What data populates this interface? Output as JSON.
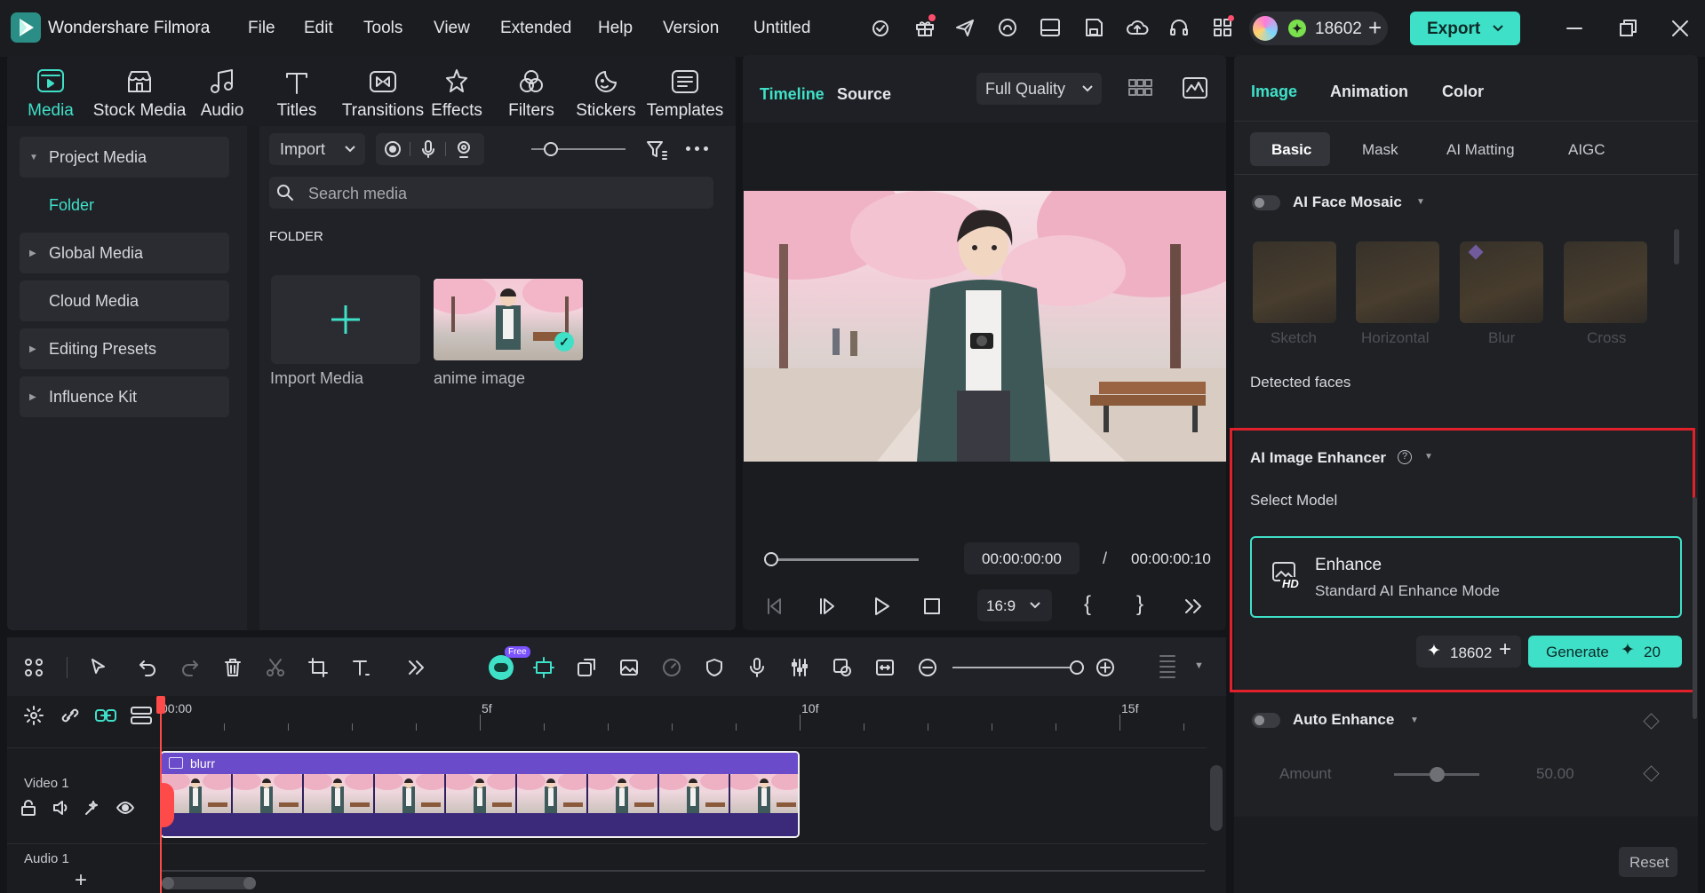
{
  "app": {
    "name": "Wondershare Filmora",
    "project": "Untitled",
    "credits": "18602",
    "export_label": "Export"
  },
  "menu": [
    "File",
    "Edit",
    "Tools",
    "View",
    "Extended",
    "Help",
    "Version"
  ],
  "media_tabs": [
    "Media",
    "Stock Media",
    "Audio",
    "Titles",
    "Transitions",
    "Effects",
    "Filters",
    "Stickers",
    "Templates"
  ],
  "sidebar": {
    "items": [
      "Project Media",
      "Folder",
      "Global Media",
      "Cloud Media",
      "Editing Presets",
      "Influence Kit"
    ]
  },
  "media": {
    "import_label": "Import",
    "search_placeholder": "Search media",
    "folder_label": "FOLDER",
    "items": [
      "Import Media",
      "anime image"
    ]
  },
  "preview": {
    "tabs": [
      "Timeline",
      "Source"
    ],
    "quality": "Full Quality",
    "current_time": "00:00:00:00",
    "separator": "/",
    "total_time": "00:00:00:10",
    "ratio": "16:9",
    "progress": 0
  },
  "timeline": {
    "ruler": [
      "00:00",
      "5f",
      "10f",
      "15f"
    ],
    "clip_name": "blurr",
    "tracks": [
      "Video 1",
      "Audio 1"
    ],
    "free_badge": "Free"
  },
  "properties": {
    "tabs": [
      "Image",
      "Animation",
      "Color"
    ],
    "subtabs": [
      "Basic",
      "Mask",
      "AI Matting",
      "AIGC"
    ],
    "face_mosaic": {
      "label": "AI Face Mosaic",
      "options": [
        "Sketch",
        "Horizontal",
        "Blur",
        "Cross"
      ],
      "detected": "Detected faces"
    },
    "enhancer": {
      "title": "AI Image Enhancer",
      "select_model": "Select Model",
      "model_name": "Enhance",
      "model_desc": "Standard AI Enhance Mode",
      "model_icon_text": "HD",
      "credits": "18602",
      "generate_label": "Generate",
      "generate_cost": "20"
    },
    "auto_enhance": {
      "label": "Auto Enhance",
      "amount_label": "Amount",
      "amount_value": "50.00",
      "amount_fraction": 0.5
    },
    "reset_label": "Reset"
  },
  "colors": {
    "accent": "#3fe0c8",
    "highlight_border": "#e0202a",
    "clip_header": "#6a4bc9"
  }
}
